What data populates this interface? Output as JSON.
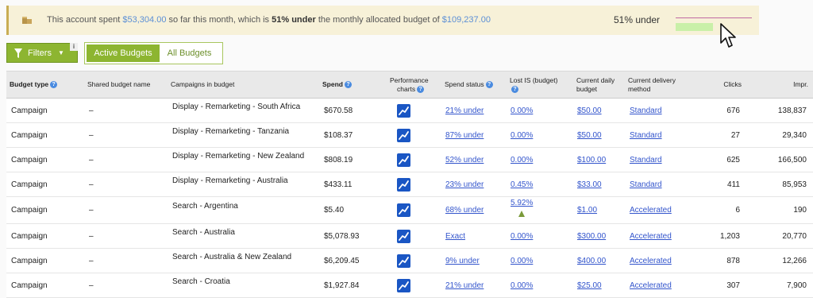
{
  "banner": {
    "icon": "coin-stack-icon",
    "text_1": "This account spent ",
    "spent": "$53,304.00",
    "text_2": " so far this month, which is ",
    "percent": "51% under",
    "text_3": " the monthly allocated budget of ",
    "budget": "$109,237.00",
    "status": "51% under",
    "fill_fraction": 0.49,
    "bar_color": "#c9f0a8",
    "line_color": "#c06aa3"
  },
  "controls": {
    "filters_label": "Filters",
    "filters_info": "i",
    "active_label": "Active Budgets",
    "all_label": "All Budgets"
  },
  "table": {
    "headers": {
      "budget_type": "Budget type",
      "shared_name": "Shared budget name",
      "campaigns": "Campaigns in budget",
      "spend": "Spend",
      "perf_1": "Performance",
      "perf_2": "charts",
      "status": "Spend status",
      "lost_1": "Lost IS (budget)",
      "daily_1": "Current daily",
      "daily_2": "budget",
      "delivery_1": "Current delivery",
      "delivery_2": "method",
      "clicks": "Clicks",
      "impr": "Impr."
    },
    "rows": [
      {
        "type": "Campaign",
        "shared": "–",
        "campaign": "Display - Remarketing - South Africa",
        "spend": "$670.58",
        "status": "21% under",
        "lost": "0.00%",
        "daily": "$50.00",
        "delivery": "Standard",
        "clicks": "676",
        "impr": "138,837"
      },
      {
        "type": "Campaign",
        "shared": "–",
        "campaign": "Display - Remarketing - Tanzania",
        "spend": "$108.37",
        "status": "87% under",
        "lost": "0.00%",
        "daily": "$50.00",
        "delivery": "Standard",
        "clicks": "27",
        "impr": "29,340"
      },
      {
        "type": "Campaign",
        "shared": "–",
        "campaign": "Display - Remarketing - New Zealand",
        "spend": "$808.19",
        "status": "52% under",
        "lost": "0.00%",
        "daily": "$100.00",
        "delivery": "Standard",
        "clicks": "625",
        "impr": "166,500"
      },
      {
        "type": "Campaign",
        "shared": "–",
        "campaign": "Display - Remarketing - Australia",
        "spend": "$433.11",
        "status": "23% under",
        "lost": "0.45%",
        "daily": "$33.00",
        "delivery": "Standard",
        "clicks": "411",
        "impr": "85,953"
      },
      {
        "type": "Campaign",
        "shared": "–",
        "campaign": "Search - Argentina",
        "spend": "$5.40",
        "status": "68% under",
        "lost": "5.92%",
        "daily": "$1.00",
        "delivery": "Accelerated",
        "clicks": "6",
        "impr": "190"
      },
      {
        "type": "Campaign",
        "shared": "–",
        "campaign": "Search - Australia",
        "spend": "$5,078.93",
        "status": "Exact",
        "lost": "0.00%",
        "daily": "$300.00",
        "delivery": "Accelerated",
        "clicks": "1,203",
        "impr": "20,770"
      },
      {
        "type": "Campaign",
        "shared": "–",
        "campaign": "Search - Australia & New Zealand",
        "spend": "$6,209.45",
        "status": "9% under",
        "lost": "0.00%",
        "daily": "$400.00",
        "delivery": "Accelerated",
        "clicks": "878",
        "impr": "12,266"
      },
      {
        "type": "Campaign",
        "shared": "–",
        "campaign": "Search - Croatia",
        "spend": "$1,927.84",
        "status": "21% under",
        "lost": "0.00%",
        "daily": "$25.00",
        "delivery": "Accelerated",
        "clicks": "307",
        "impr": "7,900"
      }
    ]
  }
}
